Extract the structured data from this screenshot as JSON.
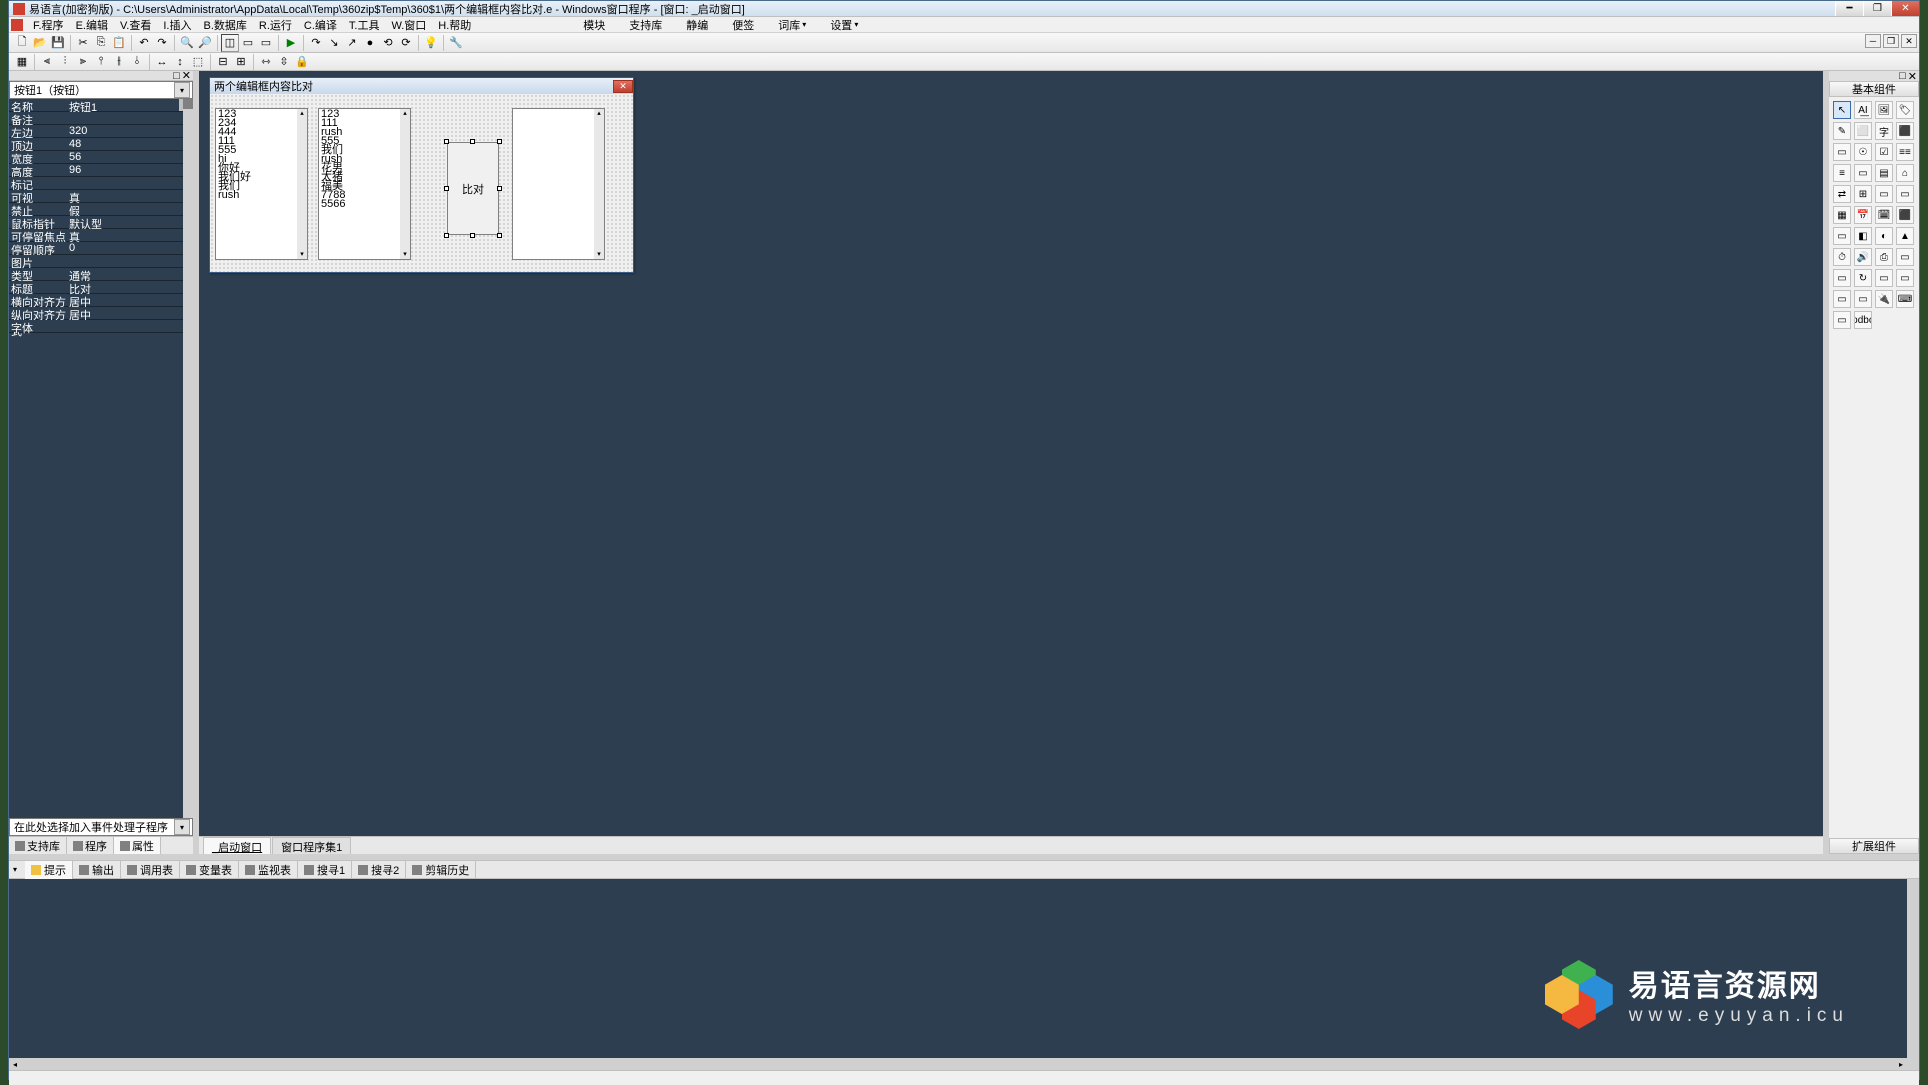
{
  "title": "易语言(加密狗版) - C:\\Users\\Administrator\\AppData\\Local\\Temp\\360zip$Temp\\360$1\\两个编辑框内容比对.e - Windows窗口程序 - [窗口: _启动窗口]",
  "menu": [
    "F.程序",
    "E.编辑",
    "V.查看",
    "I.插入",
    "B.数据库",
    "R.运行",
    "C.编译",
    "T.工具",
    "W.窗口",
    "H.帮助"
  ],
  "menu_right": [
    "模块",
    "支持库",
    "静编",
    "便签",
    "词库",
    "设置"
  ],
  "prop_combo": "按钮1（按钮）",
  "props": [
    {
      "n": "名称",
      "v": "按钮1"
    },
    {
      "n": "备注",
      "v": ""
    },
    {
      "n": "左边",
      "v": "320"
    },
    {
      "n": "顶边",
      "v": "48"
    },
    {
      "n": "宽度",
      "v": "56"
    },
    {
      "n": "高度",
      "v": "96"
    },
    {
      "n": "标记",
      "v": ""
    },
    {
      "n": "可视",
      "v": "真"
    },
    {
      "n": "禁止",
      "v": "假"
    },
    {
      "n": "鼠标指针",
      "v": "默认型"
    },
    {
      "n": "可停留焦点",
      "v": "真"
    },
    {
      "n": "  停留顺序",
      "v": "0"
    },
    {
      "n": "图片",
      "v": ""
    },
    {
      "n": "类型",
      "v": "通常"
    },
    {
      "n": "标题",
      "v": "比对"
    },
    {
      "n": "横向对齐方式",
      "v": "居中"
    },
    {
      "n": "纵向对齐方式",
      "v": "居中"
    },
    {
      "n": "字体",
      "v": ""
    }
  ],
  "event_combo": "在此处选择加入事件处理子程序",
  "left_tabs": [
    "支持库",
    "程序",
    "属性"
  ],
  "form_title": "两个编辑框内容比对",
  "edit1": "123\n234\n444\n111\n555\nhi\n你好\n我们好\n我们\nrush",
  "edit2": "123\n111\nrush\n555\n我们\nrush\n花男\n太猪\n福美\n7788\n5566",
  "btn_label": "比对",
  "center_tabs": [
    "_启动窗口",
    "窗口程序集1"
  ],
  "right_hdr": "基本组件",
  "right_ftr": "扩展组件",
  "bottom_tabs": [
    "提示",
    "输出",
    "调用表",
    "变量表",
    "监视表",
    "搜寻1",
    "搜寻2",
    "剪辑历史"
  ],
  "watermark": {
    "line1": "易语言资源网",
    "line2": "www.eyuyan.icu"
  },
  "palette_glyphs": [
    "↖",
    "A͟I",
    "🖼",
    "🏷",
    "✎",
    "⬜",
    "字",
    "⬛",
    "▭",
    "☉",
    "☑",
    "≡≡",
    "≡",
    "▭",
    "▤",
    "⌂",
    "⇄",
    "⊞",
    "▭",
    "▭",
    "▦",
    "📅",
    "🗓",
    "⬛",
    "▭",
    "◧",
    "◐",
    "▲",
    "⏱",
    "🔊",
    "⎙",
    "▭",
    "▭",
    "↻",
    "▭",
    "▭",
    "▭",
    "▭",
    "🔌",
    "⌨",
    "▭",
    "odbc"
  ]
}
